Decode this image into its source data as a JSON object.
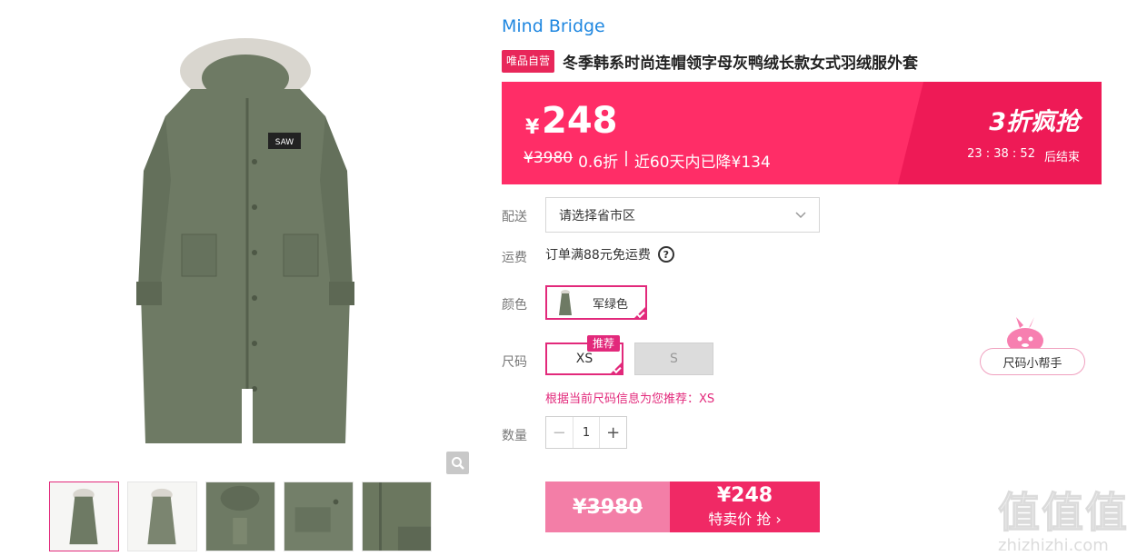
{
  "brand": "Mind Bridge",
  "badge": "唯品自营",
  "title": "冬季韩系时尚连帽领字母灰鸭绒长款女式羽绒服外套",
  "price": {
    "currency": "¥",
    "amount": "248",
    "original": "¥3980",
    "discount": "0.6折",
    "separator": "|",
    "drop": "近60天内已降¥134",
    "promo": "3折疯抢",
    "countdown": "23 : 38 : 52",
    "countdown_suffix": "后结束"
  },
  "shipping": {
    "label": "配送",
    "placeholder": "请选择省市区",
    "fee_label": "运费",
    "fee_text": "订单满88元免运费",
    "help_glyph": "?"
  },
  "color": {
    "label": "颜色",
    "selected": "军绿色"
  },
  "size": {
    "label": "尺码",
    "options": [
      "XS",
      "S"
    ],
    "recommend_tag": "推荐",
    "hint": "根据当前尺码信息为您推荐：XS"
  },
  "quantity": {
    "label": "数量",
    "value": "1",
    "minus": "−",
    "plus": "+"
  },
  "buy": {
    "original": "¥3980",
    "price": "¥248",
    "label": "特卖价 抢 ›"
  },
  "size_helper": "尺码小帮手",
  "watermark": {
    "main": "值值值",
    "sub": "zhizhizhi.com"
  },
  "colors": {
    "accent": "#e2297b",
    "band": "#ff2d67",
    "brand_link": "#1f87e0",
    "coat": "#6e7a64"
  },
  "icons": [
    "zoom-icon",
    "chevron-down-icon",
    "question-icon",
    "check-corner-icon",
    "mascot-icon"
  ]
}
